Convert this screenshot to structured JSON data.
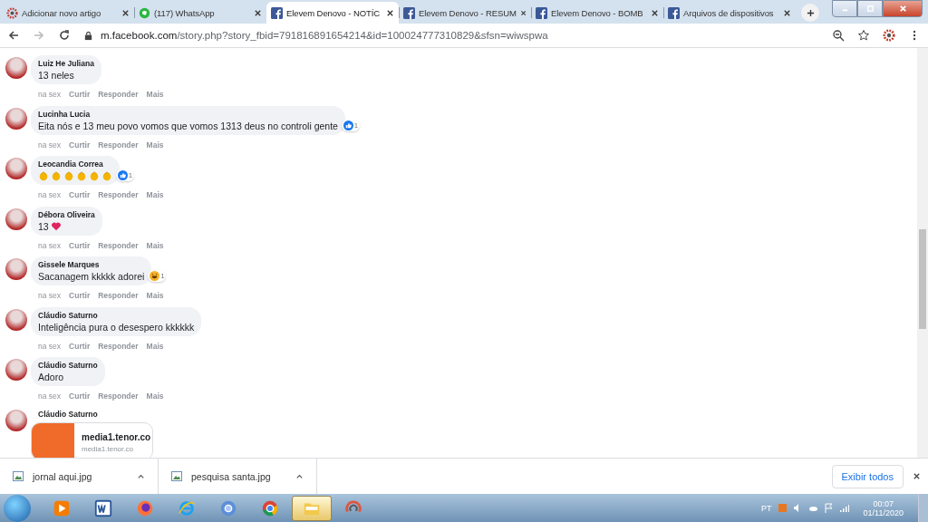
{
  "tabs": [
    {
      "kind": "gear",
      "title": "Adicionar novo artigo",
      "selected": false
    },
    {
      "kind": "whatsapp",
      "title": "(117) WhatsApp",
      "selected": false
    },
    {
      "kind": "facebook",
      "title": "Elevem Denovo - NOTÍC",
      "selected": true
    },
    {
      "kind": "facebook",
      "title": "Elevem Denovo - RESUM",
      "selected": false
    },
    {
      "kind": "facebook",
      "title": "Elevem Denovo - BOMB",
      "selected": false
    },
    {
      "kind": "facebook",
      "title": "Arquivos de dispositivos",
      "selected": false
    }
  ],
  "address_bar": {
    "host": "m.facebook.com",
    "path": "/story.php?story_fbid=791816891654214&id=100024777310829&sfsn=wiwspwa"
  },
  "comments": [
    {
      "author": "Luiz He Juliana",
      "text": "13 neles",
      "actions": [
        "na sex",
        "Curtir",
        "Responder",
        "Mais"
      ]
    },
    {
      "author": "Lucinha Lucia",
      "text": "Eita nós e 13 meu povo vomos que vomos 1313 deus no controli gente",
      "reaction": {
        "kind": "like",
        "count": "1"
      },
      "actions": [
        "na sex",
        "Curtir",
        "Responder",
        "Mais"
      ]
    },
    {
      "author": "Leocandia Correa",
      "emojis": [
        {
          "kind": "clap"
        },
        {
          "kind": "clap"
        },
        {
          "kind": "clap"
        },
        {
          "kind": "clap"
        },
        {
          "kind": "clap"
        },
        {
          "kind": "clap"
        }
      ],
      "reaction": {
        "kind": "like",
        "count": "1"
      },
      "actions": [
        "na sex",
        "Curtir",
        "Responder",
        "Mais"
      ]
    },
    {
      "author": "Débora Oliveira",
      "text": "13",
      "emojis": [
        {
          "kind": "heart"
        }
      ],
      "actions": [
        "na sex",
        "Curtir",
        "Responder",
        "Mais"
      ]
    },
    {
      "author": "Gissele Marques",
      "text": "Sacanagem kkkkk adorei",
      "reaction": {
        "kind": "haha",
        "count": "1"
      },
      "actions": [
        "na sex",
        "Curtir",
        "Responder",
        "Mais"
      ]
    },
    {
      "author": "Cláudio Saturno",
      "text": "Inteligência pura o desespero kkkkkk",
      "actions": [
        "na sex",
        "Curtir",
        "Responder",
        "Mais"
      ]
    },
    {
      "author": "Cláudio Saturno",
      "text": "Adoro",
      "actions": [
        "na sex",
        "Curtir",
        "Responder",
        "Mais"
      ]
    },
    {
      "author": "Cláudio Saturno",
      "link": {
        "title": "media1.tenor.co",
        "subtitle": "media1.tenor.co"
      }
    }
  ],
  "downloads": {
    "items": [
      "jornal aqui.jpg",
      "pesquisa santa.jpg"
    ],
    "show_all": "Exibir todos"
  },
  "taskbar": {
    "apps": [
      {
        "kind": "media",
        "selected": false
      },
      {
        "kind": "word",
        "selected": false
      },
      {
        "kind": "firefox",
        "selected": false
      },
      {
        "kind": "ie",
        "selected": false
      },
      {
        "kind": "chromium",
        "selected": false
      },
      {
        "kind": "chrome",
        "selected": false
      },
      {
        "kind": "folder",
        "selected": true
      },
      {
        "kind": "recorder",
        "selected": false
      }
    ],
    "language": "PT",
    "time": "00:07",
    "date": "01/11/2020"
  }
}
